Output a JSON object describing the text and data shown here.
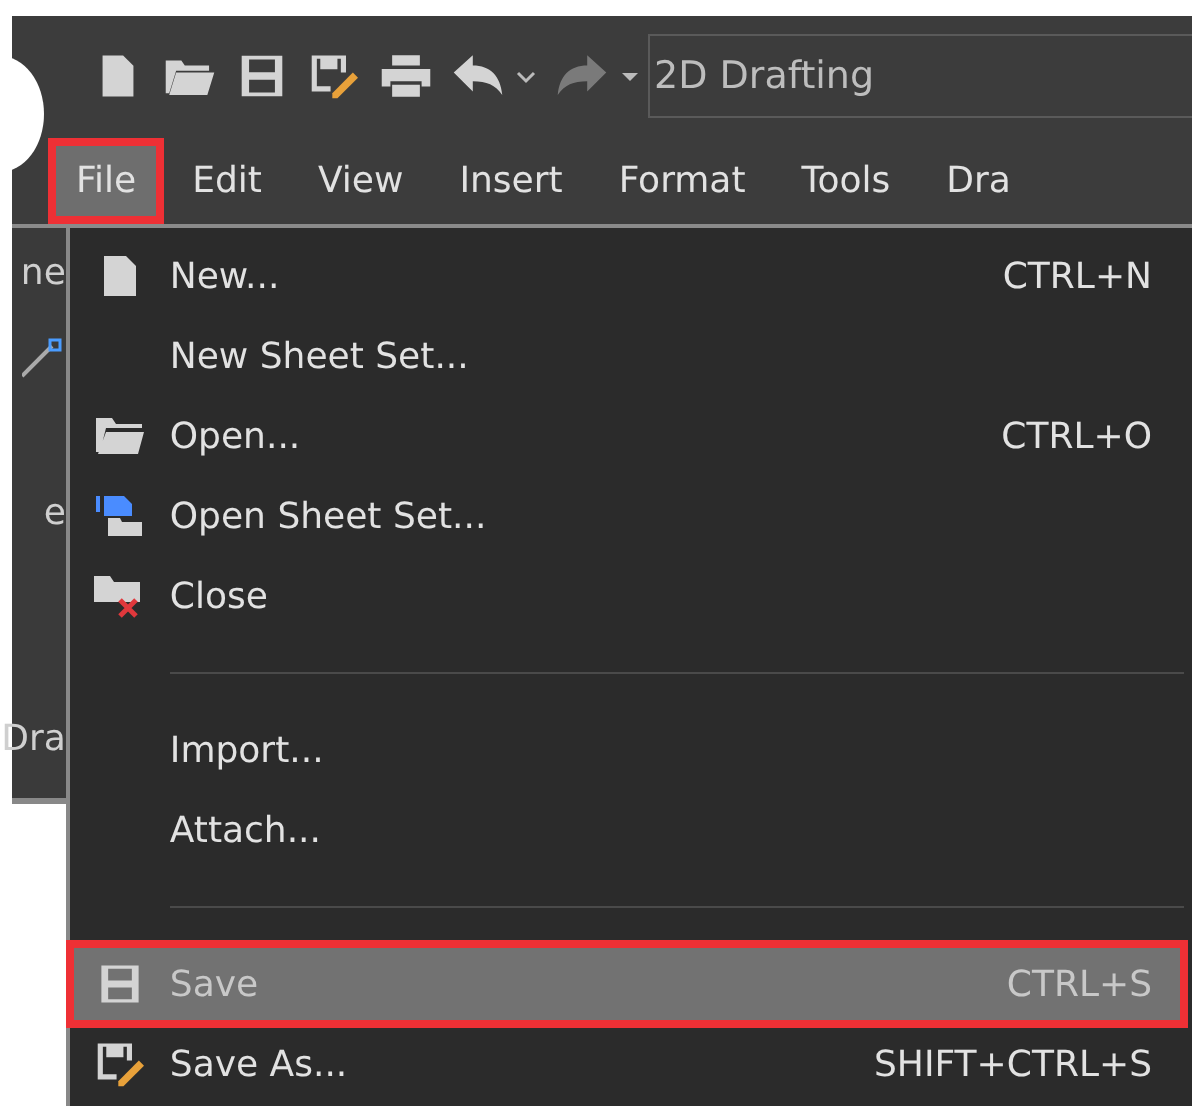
{
  "toolbar": {
    "workspace": "2D Drafting"
  },
  "menubar": [
    {
      "label": "File",
      "selected": true
    },
    {
      "label": "Edit",
      "selected": false
    },
    {
      "label": "View",
      "selected": false
    },
    {
      "label": "Insert",
      "selected": false
    },
    {
      "label": "Format",
      "selected": false
    },
    {
      "label": "Tools",
      "selected": false
    },
    {
      "label": "Dra",
      "selected": false
    }
  ],
  "background_panel": [
    "ne",
    "e",
    "Dra"
  ],
  "file_menu": [
    {
      "kind": "document",
      "label": "New...",
      "shortcut": "CTRL+N",
      "selected": false
    },
    {
      "kind": "plain",
      "label": "New Sheet Set...",
      "selected": false
    },
    {
      "kind": "folder",
      "label": "Open...",
      "shortcut": "CTRL+O",
      "selected": false
    },
    {
      "kind": "sheetset",
      "label": "Open Sheet Set...",
      "selected": false
    },
    {
      "kind": "close",
      "label": "Close",
      "selected": false
    },
    {
      "kind": "separator"
    },
    {
      "kind": "plain",
      "label": "Import...",
      "selected": false
    },
    {
      "kind": "plain",
      "label": "Attach...",
      "selected": false
    },
    {
      "kind": "separator"
    },
    {
      "kind": "save",
      "label": "Save",
      "shortcut": "CTRL+S",
      "selected": true
    },
    {
      "kind": "saveas",
      "label": "Save As...",
      "shortcut": "SHIFT+CTRL+S",
      "selected": false
    }
  ]
}
